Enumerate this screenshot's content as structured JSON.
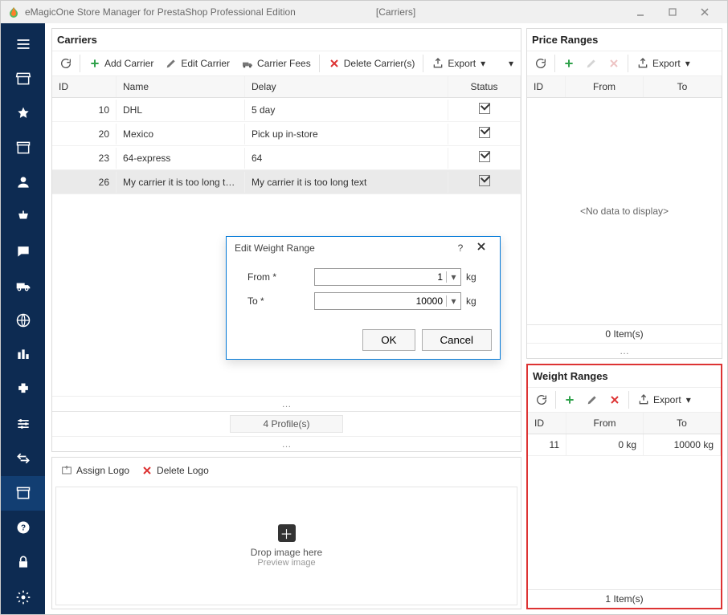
{
  "window": {
    "title_prefix": "eMagicOne Store Manager for PrestaShop Professional Edition",
    "title_suffix": "[Carriers]"
  },
  "sidebar_items": [
    "menu",
    "store",
    "star",
    "archive",
    "user",
    "cart",
    "chat",
    "truck",
    "globe",
    "chart",
    "plugin",
    "sliders",
    "sync",
    "archive2",
    "help",
    "lock",
    "settings"
  ],
  "carriers": {
    "title": "Carriers",
    "toolbar": {
      "refresh": "",
      "add": "Add Carrier",
      "edit": "Edit Carrier",
      "fees": "Carrier Fees",
      "delete": "Delete Carrier(s)",
      "export": "Export"
    },
    "columns": {
      "id": "ID",
      "name": "Name",
      "delay": "Delay",
      "status": "Status"
    },
    "rows": [
      {
        "id": "10",
        "name": "DHL",
        "delay": "5 day",
        "status": true,
        "selected": false
      },
      {
        "id": "20",
        "name": "Mexico",
        "delay": "Pick up in-store",
        "status": true,
        "selected": false
      },
      {
        "id": "23",
        "name": "64-express",
        "delay": "64",
        "status": true,
        "selected": false
      },
      {
        "id": "26",
        "name": "My carrier it is too long text",
        "delay": "My carrier it is too long text",
        "status": true,
        "selected": true
      }
    ],
    "footer": "4 Profile(s)"
  },
  "logo_panel": {
    "assign": "Assign Logo",
    "delete": "Delete Logo",
    "drop_title": "Drop image here",
    "drop_sub": "Preview image"
  },
  "price_ranges": {
    "title": "Price Ranges",
    "columns": {
      "id": "ID",
      "from": "From",
      "to": "To"
    },
    "nodata": "<No data to display>",
    "count": "0 Item(s)",
    "export": "Export"
  },
  "weight_ranges": {
    "title": "Weight Ranges",
    "columns": {
      "id": "ID",
      "from": "From",
      "to": "To"
    },
    "rows": [
      {
        "id": "11",
        "from": "0 kg",
        "to": "10000 kg"
      }
    ],
    "count": "1 Item(s)",
    "export": "Export"
  },
  "modal": {
    "title": "Edit Weight Range",
    "help": "?",
    "from_label": "From *",
    "to_label": "To *",
    "from_value": "1",
    "to_value": "10000",
    "unit": "kg",
    "ok": "OK",
    "cancel": "Cancel"
  }
}
